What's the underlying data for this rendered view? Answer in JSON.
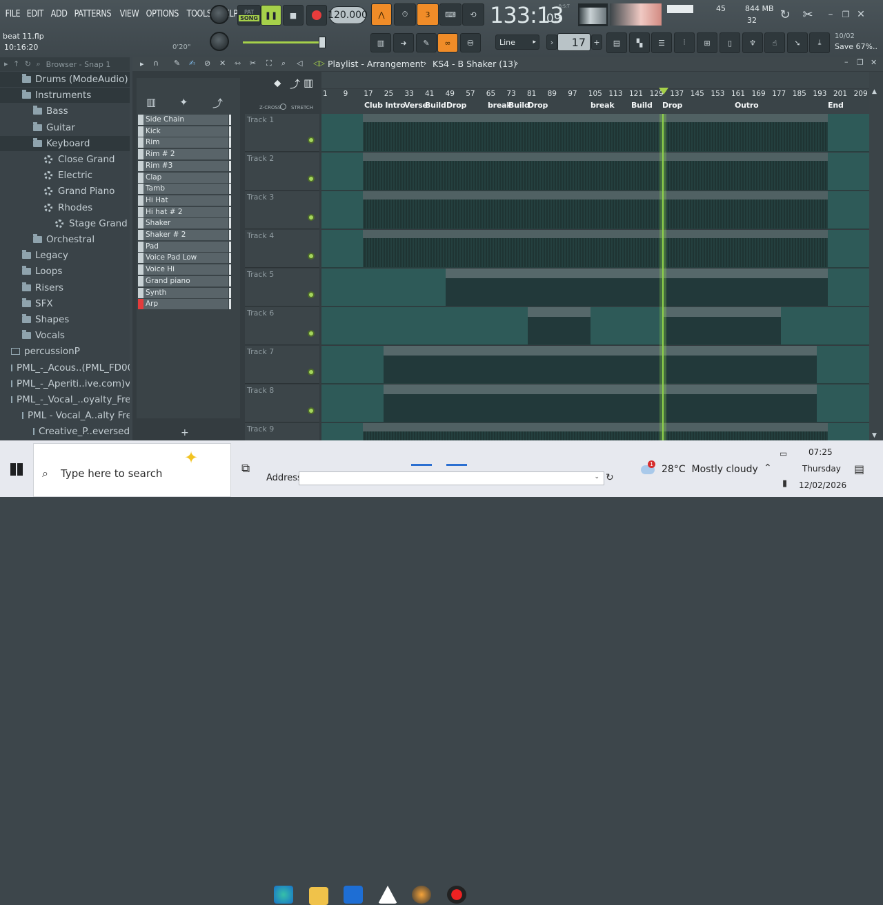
{
  "menu": [
    "FILE",
    "EDIT",
    "ADD",
    "PATTERNS",
    "VIEW",
    "OPTIONS",
    "TOOLS",
    "HELP"
  ],
  "transport": {
    "pat": "PAT",
    "song": "SONG",
    "tempo": "120.000",
    "time": "133:13",
    "time_small": "09",
    "bst": "B:S:T",
    "meter_num": "32"
  },
  "memory": {
    "value": "844 MB",
    "cpu": "45",
    "poly": "32"
  },
  "project": {
    "file": "beat 11.flp",
    "time": "10:16:20",
    "elapsed": "0'20\""
  },
  "tools": {
    "snap": "Line",
    "step": "17"
  },
  "news": {
    "date": "10/02",
    "text": "Save 67%.."
  },
  "browser": {
    "title": "Browser - Snap 1",
    "items": [
      {
        "label": "Drums (ModeAudio)",
        "kind": "folder",
        "indent": 1
      },
      {
        "label": "Instruments",
        "kind": "folder",
        "indent": 1
      },
      {
        "label": "Bass",
        "kind": "folder",
        "indent": 2
      },
      {
        "label": "Guitar",
        "kind": "folder",
        "indent": 2
      },
      {
        "label": "Keyboard",
        "kind": "folder",
        "indent": 2
      },
      {
        "label": "Close Grand",
        "kind": "gear",
        "indent": 3
      },
      {
        "label": "Electric",
        "kind": "gear",
        "indent": 3
      },
      {
        "label": "Grand Piano",
        "kind": "gear",
        "indent": 3
      },
      {
        "label": "Rhodes",
        "kind": "gear",
        "indent": 3
      },
      {
        "label": "Stage Grand",
        "kind": "gear",
        "indent": 4
      },
      {
        "label": "Orchestral",
        "kind": "folder",
        "indent": 2
      },
      {
        "label": "Legacy",
        "kind": "folder",
        "indent": 1
      },
      {
        "label": "Loops",
        "kind": "folder",
        "indent": 1
      },
      {
        "label": "Risers",
        "kind": "folder",
        "indent": 1
      },
      {
        "label": "SFX",
        "kind": "folder",
        "indent": 1
      },
      {
        "label": "Shapes",
        "kind": "folder",
        "indent": 1
      },
      {
        "label": "Vocals",
        "kind": "folder",
        "indent": 1
      },
      {
        "label": "percussionP",
        "kind": "ofolder",
        "indent": 0
      },
      {
        "label": "PML_-_Acous..(PML_FD005)",
        "kind": "ofolder",
        "indent": 0
      },
      {
        "label": "PML_-_Aperiti..ive.com)v1.1",
        "kind": "ofolder",
        "indent": 0
      },
      {
        "label": "PML_-_Vocal_..oyalty_Free",
        "kind": "ofolder",
        "indent": 0
      },
      {
        "label": "PML - Vocal_A..alty Free",
        "kind": "ofolder",
        "indent": 1
      },
      {
        "label": "Creative_P..eversed)",
        "kind": "ofolder",
        "indent": 2
      }
    ]
  },
  "playlist": {
    "title": "Playlist - Arrangement",
    "pattern": "KS4 - B Shaker (13)",
    "zcross": "Z-CROSS",
    "stretch": "STRETCH",
    "channels": [
      "Side Chain",
      "Kick",
      "Rim",
      "Rim # 2",
      "Rim #3",
      "Clap",
      "Tamb",
      "Hi Hat",
      "Hi hat # 2",
      "Shaker",
      "Shaker # 2",
      "Pad",
      "Voice Pad Low",
      "Voice Hi",
      "Grand piano",
      "Synth",
      "Arp"
    ],
    "ticks": [
      "1",
      "9",
      "17",
      "25",
      "33",
      "41",
      "49",
      "57",
      "65",
      "73",
      "81",
      "89",
      "97",
      "105",
      "113",
      "121",
      "129",
      "137",
      "145",
      "153",
      "161",
      "169",
      "177",
      "185",
      "193",
      "201",
      "209"
    ],
    "markers": [
      "Club Intro",
      "Verse",
      "Build",
      "Drop",
      "break",
      "Build",
      "Drop",
      "break",
      "Build",
      "Drop",
      "Outro",
      "End"
    ],
    "tracks": [
      "Track 1",
      "Track 2",
      "Track 3",
      "Track 4",
      "Track 5",
      "Track 6",
      "Track 7",
      "Track 8",
      "Track 9"
    ]
  },
  "taskbar": {
    "search_placeholder": "Type here to search",
    "address_label": "Address",
    "weather": "28°C  Mostly cloudy",
    "time": "07:25",
    "day": "Thursday",
    "date": "12/02/2026",
    "weather_badge": "1"
  }
}
